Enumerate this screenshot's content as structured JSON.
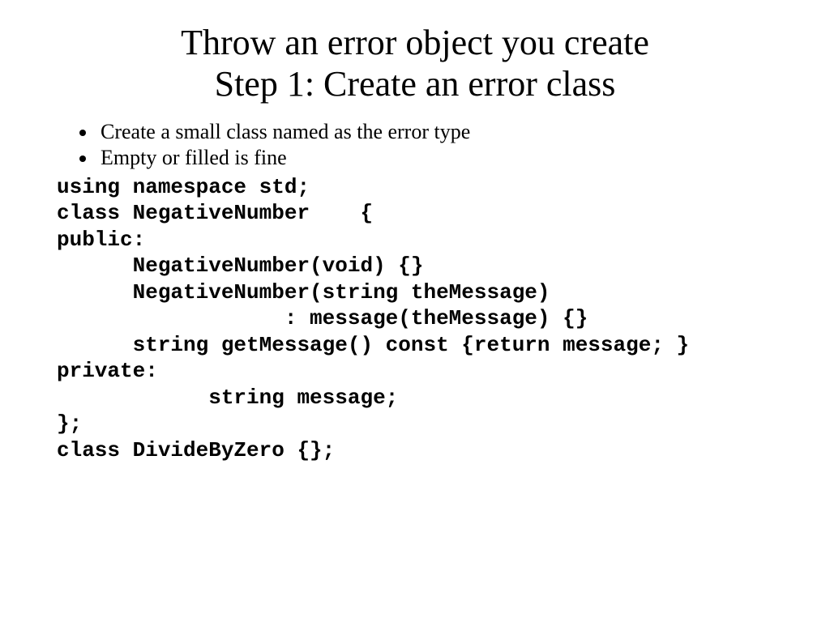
{
  "title_line1": "Throw an error object you create",
  "title_line2": "Step 1: Create an error class",
  "bullets": {
    "b1": "Create a small class named as the error type",
    "b2": "Empty or filled is fine"
  },
  "code": {
    "l1": "using namespace std;",
    "l2": "class NegativeNumber    {",
    "l3": "public:",
    "l4": "      NegativeNumber(void) {}",
    "l5": "      NegativeNumber(string theMessage)",
    "l6": "                  : message(theMessage) {}",
    "l7": "      string getMessage() const {return message; }",
    "l8": "private:",
    "l9": "            string message;",
    "l10": "};",
    "l11": "class DivideByZero {};"
  }
}
